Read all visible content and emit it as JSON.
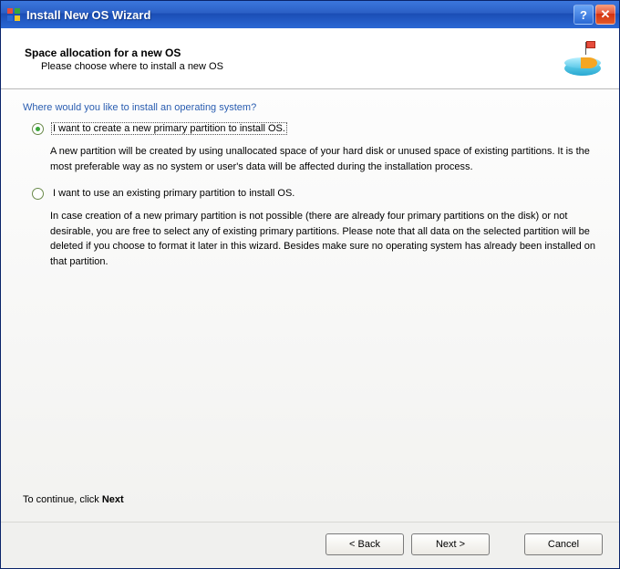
{
  "titlebar": {
    "title": "Install New OS Wizard",
    "help_label": "?",
    "close_label": "✕"
  },
  "header": {
    "title": "Space allocation for a new OS",
    "subtitle": "Please choose where to install a new OS"
  },
  "content": {
    "question": "Where would you like to install an operating system?",
    "option1": {
      "label": "I want to create a new primary partition to install OS.",
      "selected": true,
      "description": "A new partition will be created by using unallocated space of your hard disk or unused space of existing partitions. It is the most preferable way as no system or user's data will be affected during the installation process."
    },
    "option2": {
      "label": "I want to use an existing primary partition to install OS.",
      "selected": false,
      "description": "In case creation of a new primary partition is not possible (there are already four primary partitions on the disk) or not desirable, you are free to select any of existing primary partitions. Please note that all data on the selected partition will be deleted if you choose to format it later in this wizard. Besides make sure no operating system has already been installed on that partition."
    },
    "continue_prefix": "To continue, click ",
    "continue_bold": "Next"
  },
  "footer": {
    "back_label": "< Back",
    "next_label": "Next >",
    "cancel_label": "Cancel"
  }
}
